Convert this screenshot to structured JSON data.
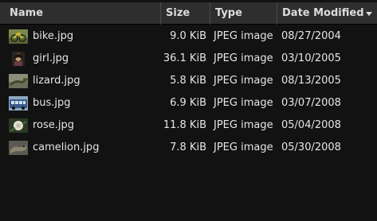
{
  "columns": {
    "name": "Name",
    "size": "Size",
    "type": "Type",
    "date": "Date Modified"
  },
  "sort": {
    "column": "date",
    "direction": "descending"
  },
  "files": [
    {
      "name": "bike.jpg",
      "size": "9.0 KiB",
      "type": "JPEG image",
      "date": "08/27/2004",
      "thumb": "bike-thumbnail"
    },
    {
      "name": "girl.jpg",
      "size": "36.1 KiB",
      "type": "JPEG image",
      "date": "03/10/2005",
      "thumb": "girl-thumbnail"
    },
    {
      "name": "lizard.jpg",
      "size": "5.8 KiB",
      "type": "JPEG image",
      "date": "08/13/2005",
      "thumb": "lizard-thumbnail"
    },
    {
      "name": "bus.jpg",
      "size": "6.9 KiB",
      "type": "JPEG image",
      "date": "03/07/2008",
      "thumb": "bus-thumbnail"
    },
    {
      "name": "rose.jpg",
      "size": "11.8 KiB",
      "type": "JPEG image",
      "date": "05/04/2008",
      "thumb": "rose-thumbnail"
    },
    {
      "name": "camelion.jpg",
      "size": "7.8 KiB",
      "type": "JPEG image",
      "date": "05/30/2008",
      "thumb": "camelion-thumbnail"
    }
  ]
}
